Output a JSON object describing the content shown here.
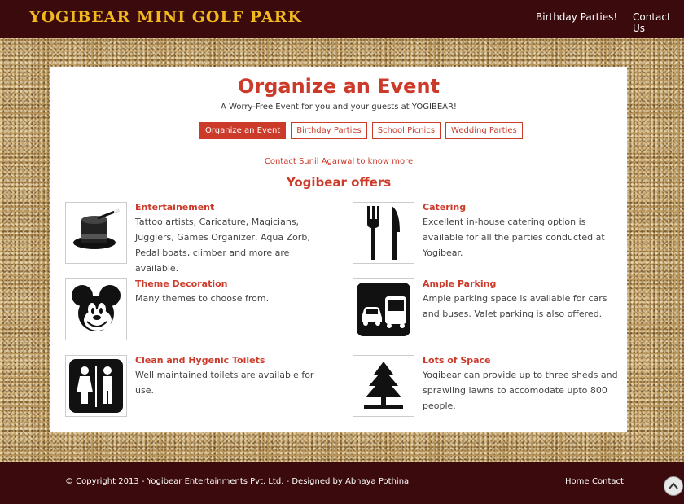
{
  "header": {
    "brand": "YOGIBEAR MINI GOLF PARK",
    "nav": [
      "Birthday Parties!",
      "Contact Us"
    ]
  },
  "page": {
    "title": "Organize an Event",
    "subtitle": "A Worry-Free Event for you and your guests at YOGIBEAR!",
    "tabs": [
      "Organize an Event",
      "Birthday Parties",
      "School Picnics",
      "Wedding Parties"
    ],
    "active_tab": "Organize an Event",
    "contact_link": "Contact Sunil Agarwal to know more",
    "offers_heading": "Yogibear offers"
  },
  "offers": [
    {
      "title": "Entertainement",
      "desc": "Tattoo artists, Caricature, Magicians, Jugglers, Games Organizer, Aqua Zorb, Pedal boats, climber and more are available.",
      "icon": "magic-hat-icon"
    },
    {
      "title": "Catering",
      "desc": "Excellent in-house catering option is available for all the parties conducted at Yogibear.",
      "icon": "fork-knife-icon"
    },
    {
      "title": "Theme Decoration",
      "desc": "Many themes to choose from.",
      "icon": "mickey-mouse-icon"
    },
    {
      "title": "Ample Parking",
      "desc": "Ample parking space is available for cars and buses. Valet parking is also offered.",
      "icon": "parking-vehicles-icon"
    },
    {
      "title": "Clean and Hygenic Toilets",
      "desc": "Well maintained toilets are available for use.",
      "icon": "restroom-icon"
    },
    {
      "title": "Lots of Space",
      "desc": "Yogibear can provide up to three sheds and sprawling lawns to accomodate upto 800 people.",
      "icon": "tree-icon"
    }
  ],
  "footer": {
    "copyright": "© Copyright 2013 - Yogibear Entertainments Pvt. Ltd. - Designed by Abhaya Pothina",
    "links": [
      "Home",
      "Contact"
    ]
  },
  "colors": {
    "header_bg": "#3a0a0c",
    "brand": "#f2b81f",
    "accent": "#cc3a2a"
  }
}
